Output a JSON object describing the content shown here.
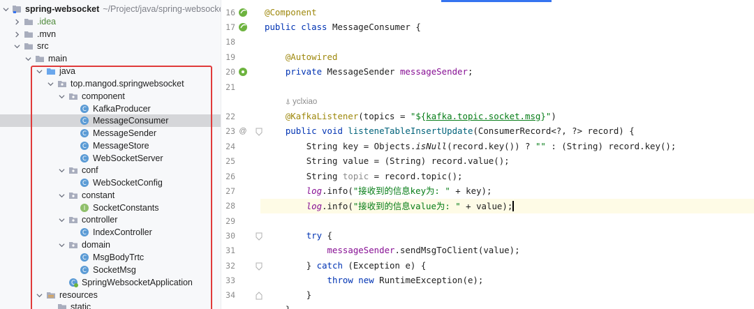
{
  "project_tree": {
    "root": {
      "name": "spring-websocket",
      "path": "~/Project/java/spring-websocke"
    },
    "items": [
      {
        "label": ".idea"
      },
      {
        "label": ".mvn"
      },
      {
        "label": "src"
      },
      {
        "label": "main"
      },
      {
        "label": "java"
      },
      {
        "label": "top.mangod.springwebsocket"
      },
      {
        "label": "component"
      },
      {
        "label": "KafkaProducer"
      },
      {
        "label": "MessageConsumer"
      },
      {
        "label": "MessageSender"
      },
      {
        "label": "MessageStore"
      },
      {
        "label": "WebSocketServer"
      },
      {
        "label": "conf"
      },
      {
        "label": "WebSocketConfig"
      },
      {
        "label": "constant"
      },
      {
        "label": "SocketConstants"
      },
      {
        "label": "controller"
      },
      {
        "label": "IndexController"
      },
      {
        "label": "domain"
      },
      {
        "label": "MsgBodyTrtc"
      },
      {
        "label": "SocketMsg"
      },
      {
        "label": "SpringWebsocketApplication"
      },
      {
        "label": "resources"
      },
      {
        "label": "static"
      }
    ],
    "selected": "MessageConsumer"
  },
  "editor": {
    "line_numbers": [
      "16",
      "17",
      "18",
      "19",
      "20",
      "21",
      "22",
      "23",
      "24",
      "25",
      "26",
      "27",
      "28",
      "29",
      "30",
      "31",
      "32",
      "33",
      "34"
    ],
    "author_hint": "yclxiao",
    "current_line": "28",
    "code": {
      "l16": "@Component",
      "l17a": "public class ",
      "l17b": "MessageConsumer {",
      "l19": "@Autowired",
      "l20a": "private ",
      "l20b": "MessageSender ",
      "l20c": "messageSender",
      "l20d": ";",
      "l22a": "@KafkaListener",
      "l22b": "(topics = ",
      "l22c": "\"${",
      "l22d": "kafka.topic.socket.msg",
      "l22e": "}\"",
      "l22f": ")",
      "l23a": "public void ",
      "l23b": "listeneTableInsertUpdate",
      "l23c": "(ConsumerRecord<?, ?> record) {",
      "l24a": "String key = Objects.",
      "l24b": "isNull",
      "l24c": "(record.key()) ? ",
      "l24d": "\"\"",
      "l24e": " : (String) record.key();",
      "l25": "String value = (String) record.value();",
      "l26a": "String ",
      "l26b": "topic",
      "l26c": " = record.topic();",
      "l27a": "log",
      "l27b": ".info(",
      "l27c": "\"接收到的信息key为: \"",
      "l27d": " + key);",
      "l28a": "log",
      "l28b": ".info(",
      "l28c": "\"接收到的信息value为: \"",
      "l28d": " + value);",
      "l30a": "try",
      "l30b": " {",
      "l31a": "messageSender",
      "l31b": ".sendMsgToClient(value);",
      "l32a": "} ",
      "l32b": "catch",
      "l32c": " (Exception e) {",
      "l33a": "throw new ",
      "l33b": "RuntimeException(e);",
      "l34": "}",
      "l35": "}"
    }
  },
  "colors": {
    "keyword": "#0033b3",
    "annotation": "#9e880d",
    "field": "#871094",
    "string": "#067d17",
    "highlight_box": "#e03a3a",
    "selection": "#d5d6d9"
  }
}
